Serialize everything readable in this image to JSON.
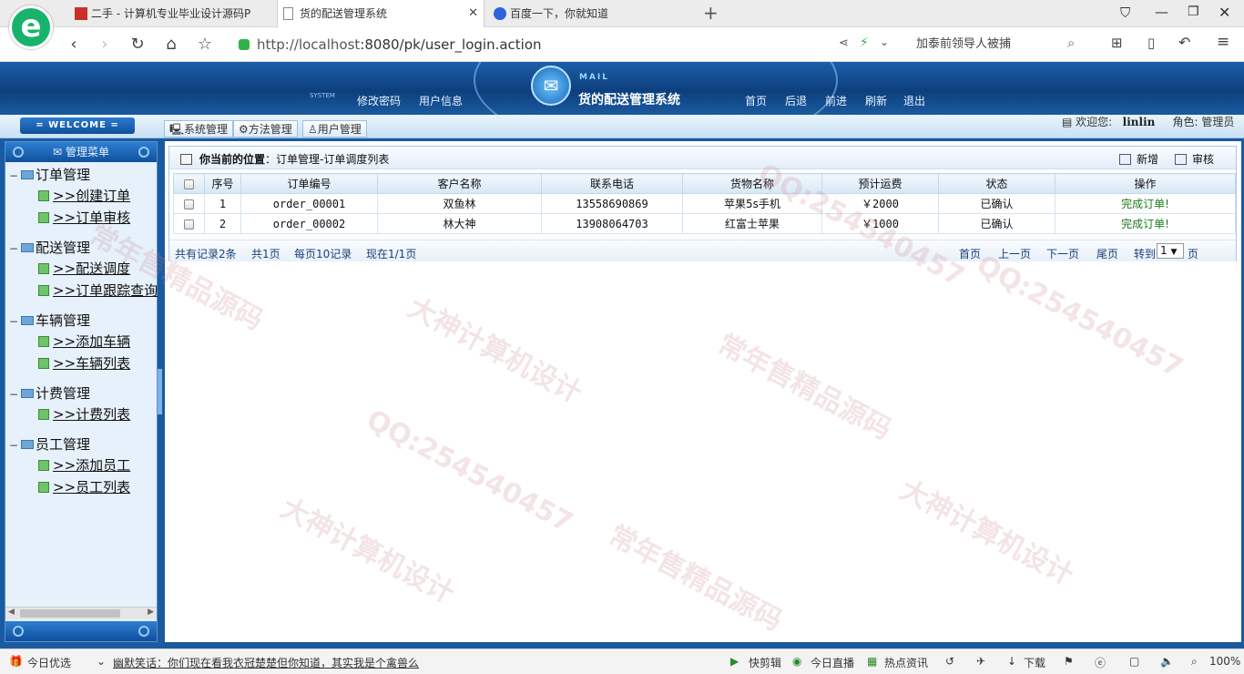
{
  "browser": {
    "tabs": [
      {
        "title": "二手 - 计算机专业毕业设计源码P",
        "active": false
      },
      {
        "title": "货的配送管理系统",
        "active": true
      },
      {
        "title": "百度一下，你就知道",
        "active": false
      }
    ],
    "new_tab_label": "+",
    "url_host": "http://localhost",
    "url_path": ":8080/pk/user_login.action",
    "news_text": "加泰前领导人被捕"
  },
  "app": {
    "system_tag": "SYSTEM",
    "mail_tag": "MAIL",
    "title": "货的配送管理系统",
    "header_left_links": [
      "修改密码",
      "用户信息"
    ],
    "header_right_links": [
      "首页",
      "后退",
      "前进",
      "刷新",
      "退出"
    ],
    "welcome": "= WELCOME =",
    "sub_tabs": [
      "系统管理",
      "方法管理",
      "用户管理"
    ],
    "user_greeting": "欢迎您:",
    "user_name": "linlin",
    "role_label": "角色:",
    "role_value": "管理员"
  },
  "sidebar": {
    "title": "管理菜单",
    "groups": [
      {
        "label": "订单管理",
        "items": [
          ">>创建订单",
          ">>订单审核"
        ]
      },
      {
        "label": "配送管理",
        "items": [
          ">>配送调度",
          ">>订单跟踪查询"
        ]
      },
      {
        "label": "车辆管理",
        "items": [
          ">>添加车辆",
          ">>车辆列表"
        ]
      },
      {
        "label": "计费管理",
        "items": [
          ">>计费列表"
        ]
      },
      {
        "label": "员工管理",
        "items": [
          ">>添加员工",
          ">>员工列表"
        ]
      }
    ]
  },
  "main": {
    "location_label": "你当前的位置",
    "location_path": "：订单管理-订单调度列表",
    "add_label": "新增",
    "audit_label": "审核",
    "columns": [
      "序号",
      "订单编号",
      "客户名称",
      "联系电话",
      "货物名称",
      "预计运费",
      "状态",
      "操作"
    ],
    "rows": [
      {
        "no": "1",
        "order_id": "order_00001",
        "customer": "双鱼林",
        "phone": "13558690869",
        "goods": "苹果5s手机",
        "fee": "￥2000",
        "status": "已确认",
        "action": "完成订单!"
      },
      {
        "no": "2",
        "order_id": "order_00002",
        "customer": "林大神",
        "phone": "13908064703",
        "goods": "红富士苹果",
        "fee": "￥1000",
        "status": "已确认",
        "action": "完成订单!"
      }
    ],
    "pager": {
      "total": "共有记录2条",
      "pages": "共1页",
      "per_page": "每页10记录",
      "current": "现在1/1页",
      "first": "首页",
      "prev": "上一页",
      "next": "下一页",
      "last": "尾页",
      "goto": "转到",
      "page_value": "1",
      "page_suffix": "页"
    }
  },
  "statusbar": {
    "today_pick": "今日优选",
    "ticker": "幽默笑话：你们现在看我衣冠楚楚但你知道，其实我是个禽兽么",
    "items": [
      "快剪辑",
      "今日直播",
      "热点资讯",
      "下载"
    ],
    "zoom": "100%"
  },
  "watermarks": [
    "大神计算机设计",
    "常年售精品源码",
    "QQ:254540457"
  ],
  "colors": {
    "header_blue": "#0d3f7e",
    "frame_blue": "#1a5aa0",
    "action_green": "#1a7a1a"
  }
}
